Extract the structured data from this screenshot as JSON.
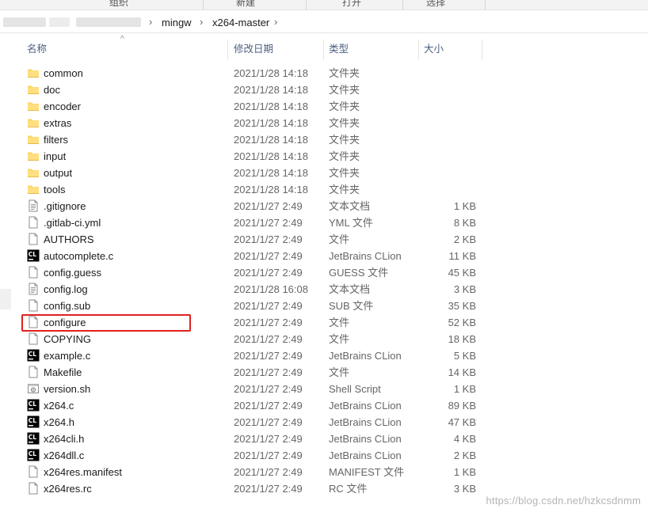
{
  "ribbon": {
    "groups": [
      "组织",
      "新建",
      "打开",
      "选择"
    ]
  },
  "address_bar": {
    "crumbs": [
      "mingw",
      "x264-master"
    ]
  },
  "columns": {
    "name": "名称",
    "date": "修改日期",
    "type": "类型",
    "size": "大小"
  },
  "files": [
    {
      "name": "common",
      "date": "2021/1/28 14:18",
      "type": "文件夹",
      "size": "",
      "icon": "folder-icon"
    },
    {
      "name": "doc",
      "date": "2021/1/28 14:18",
      "type": "文件夹",
      "size": "",
      "icon": "folder-icon"
    },
    {
      "name": "encoder",
      "date": "2021/1/28 14:18",
      "type": "文件夹",
      "size": "",
      "icon": "folder-icon"
    },
    {
      "name": "extras",
      "date": "2021/1/28 14:18",
      "type": "文件夹",
      "size": "",
      "icon": "folder-icon"
    },
    {
      "name": "filters",
      "date": "2021/1/28 14:18",
      "type": "文件夹",
      "size": "",
      "icon": "folder-icon"
    },
    {
      "name": "input",
      "date": "2021/1/28 14:18",
      "type": "文件夹",
      "size": "",
      "icon": "folder-icon"
    },
    {
      "name": "output",
      "date": "2021/1/28 14:18",
      "type": "文件夹",
      "size": "",
      "icon": "folder-icon"
    },
    {
      "name": "tools",
      "date": "2021/1/28 14:18",
      "type": "文件夹",
      "size": "",
      "icon": "folder-icon"
    },
    {
      "name": ".gitignore",
      "date": "2021/1/27 2:49",
      "type": "文本文档",
      "size": "1 KB",
      "icon": "text-file-icon"
    },
    {
      "name": ".gitlab-ci.yml",
      "date": "2021/1/27 2:49",
      "type": "YML 文件",
      "size": "8 KB",
      "icon": "file-icon"
    },
    {
      "name": "AUTHORS",
      "date": "2021/1/27 2:49",
      "type": "文件",
      "size": "2 KB",
      "icon": "file-icon"
    },
    {
      "name": "autocomplete.c",
      "date": "2021/1/27 2:49",
      "type": "JetBrains CLion",
      "size": "11 KB",
      "icon": "clion-icon"
    },
    {
      "name": "config.guess",
      "date": "2021/1/27 2:49",
      "type": "GUESS 文件",
      "size": "45 KB",
      "icon": "file-icon"
    },
    {
      "name": "config.log",
      "date": "2021/1/28 16:08",
      "type": "文本文档",
      "size": "3 KB",
      "icon": "text-file-icon"
    },
    {
      "name": "config.sub",
      "date": "2021/1/27 2:49",
      "type": "SUB 文件",
      "size": "35 KB",
      "icon": "file-icon"
    },
    {
      "name": "configure",
      "date": "2021/1/27 2:49",
      "type": "文件",
      "size": "52 KB",
      "icon": "file-icon"
    },
    {
      "name": "COPYING",
      "date": "2021/1/27 2:49",
      "type": "文件",
      "size": "18 KB",
      "icon": "file-icon"
    },
    {
      "name": "example.c",
      "date": "2021/1/27 2:49",
      "type": "JetBrains CLion",
      "size": "5 KB",
      "icon": "clion-icon"
    },
    {
      "name": "Makefile",
      "date": "2021/1/27 2:49",
      "type": "文件",
      "size": "14 KB",
      "icon": "file-icon"
    },
    {
      "name": "version.sh",
      "date": "2021/1/27 2:49",
      "type": "Shell Script",
      "size": "1 KB",
      "icon": "shell-script-icon"
    },
    {
      "name": "x264.c",
      "date": "2021/1/27 2:49",
      "type": "JetBrains CLion",
      "size": "89 KB",
      "icon": "clion-icon"
    },
    {
      "name": "x264.h",
      "date": "2021/1/27 2:49",
      "type": "JetBrains CLion",
      "size": "47 KB",
      "icon": "clion-icon"
    },
    {
      "name": "x264cli.h",
      "date": "2021/1/27 2:49",
      "type": "JetBrains CLion",
      "size": "4 KB",
      "icon": "clion-icon"
    },
    {
      "name": "x264dll.c",
      "date": "2021/1/27 2:49",
      "type": "JetBrains CLion",
      "size": "2 KB",
      "icon": "clion-icon"
    },
    {
      "name": "x264res.manifest",
      "date": "2021/1/27 2:49",
      "type": "MANIFEST 文件",
      "size": "1 KB",
      "icon": "file-icon"
    },
    {
      "name": "x264res.rc",
      "date": "2021/1/27 2:49",
      "type": "RC 文件",
      "size": "3 KB",
      "icon": "file-icon"
    }
  ],
  "highlighted_file": "configure",
  "watermark": "https://blog.csdn.net/hzkcsdnmm",
  "colors": {
    "folder": "#f8d567",
    "clion": "#000000",
    "highlight": "#e02020",
    "header_text": "#4d6082"
  }
}
